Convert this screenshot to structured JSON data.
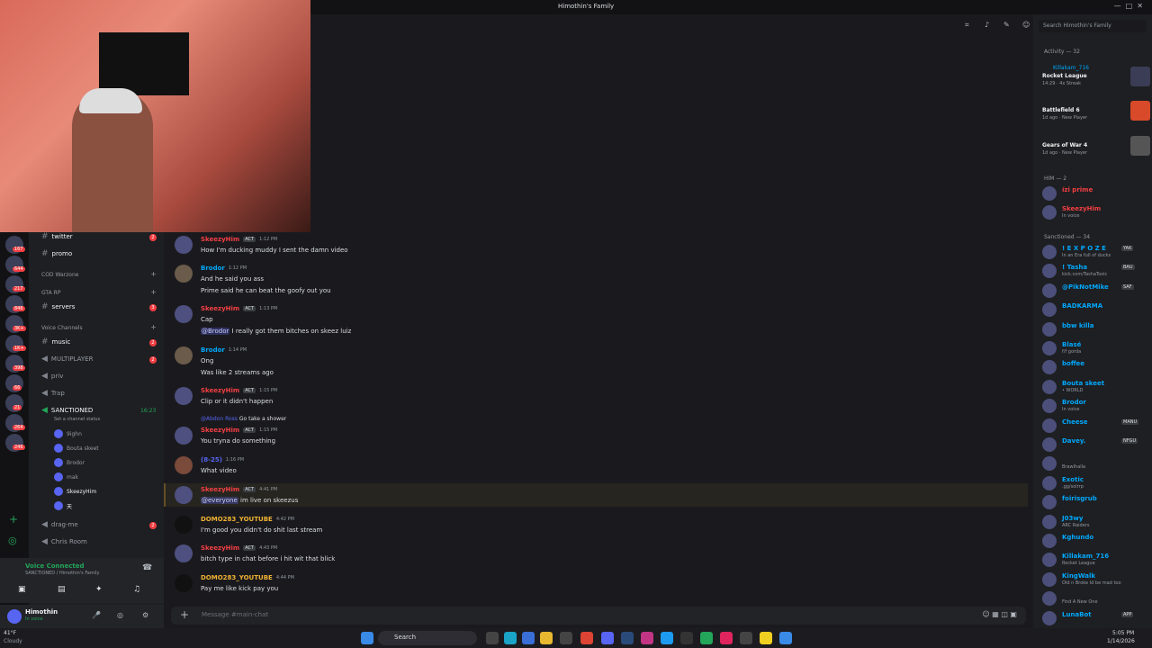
{
  "window": {
    "title": "Himothin's Family"
  },
  "search": {
    "placeholder": "Search Himothin's Family"
  },
  "server_badges": [
    "167",
    "644",
    "217",
    "846",
    "3K+",
    "1K+",
    "398",
    "66",
    "21",
    "264",
    "246"
  ],
  "channels": {
    "twitter": "twitter",
    "promo": "promo",
    "cat_cod": "COD Warzone",
    "cat_gta": "GTA RP",
    "servers": "servers",
    "cat_voice": "Voice Channels",
    "music": "music",
    "multiplayer": "MULTIPLAYER",
    "priv": "priv",
    "trap": "Trap",
    "sanctioned": "SANCTIONED",
    "sanctioned_time": "16:23",
    "set_status": "Set a channel status",
    "voice_users": [
      "9ighn",
      "Bouta skeet",
      "Brodor",
      "mak",
      "SkeezyHim",
      "天"
    ],
    "drag_me": "drag-me",
    "chris_room": "Chris Room",
    "badges": {
      "twitter": "2",
      "servers": "3",
      "music": "2",
      "multiplayer": "2",
      "drag_me": "2"
    }
  },
  "voice": {
    "status": "Voice Connected",
    "location": "SANCTIONED / Himothin's Family"
  },
  "user": {
    "name": "Himothin",
    "status": "In voice"
  },
  "weather": {
    "temp": "41°F",
    "desc": "Cloudy"
  },
  "messages": [
    {
      "author": "SkeezyHim",
      "tag": "ACT",
      "time": "1:12 PM",
      "lines": [
        "How I'm ducking muddy I sent the damn video"
      ]
    },
    {
      "author": "Brodor",
      "tag": "",
      "time": "1:12 PM",
      "lines": [
        "And he said you ass",
        "Prime said he can beat the goofy out you"
      ]
    },
    {
      "author": "SkeezyHim",
      "tag": "ACT",
      "time": "1:13 PM",
      "lines": [
        "Cap"
      ],
      "mention_line": {
        "mention": "@Brodor",
        "text": " I really got them bitches on skeez luiz"
      }
    },
    {
      "author": "Brodor",
      "tag": "",
      "time": "1:14 PM",
      "lines": [
        "Ong",
        "Was like 2 streams ago"
      ]
    },
    {
      "author": "SkeezyHim",
      "tag": "ACT",
      "time": "1:15 PM",
      "lines": [
        "Clip or it didn't happen"
      ]
    },
    {
      "author": "SkeezyHim",
      "tag": "ACT",
      "time": "1:15 PM",
      "reply": {
        "mention": "@Abdon Ross",
        "text": "Go take a shower"
      },
      "lines": [
        "You tryna do something"
      ]
    },
    {
      "author": "(8-25)",
      "tag": "",
      "time": "1:16 PM",
      "lines": [
        "What video"
      ]
    },
    {
      "author": "SkeezyHim",
      "tag": "ACT",
      "time": "4:41 PM",
      "mention_line": {
        "mention": "@everyone",
        "text": " im live on skeezus"
      }
    },
    {
      "author": "DOMO283_YOUTUBE",
      "tag": "",
      "time": "4:42 PM",
      "lines": [
        "I'm good you didn't do shit last stream"
      ]
    },
    {
      "author": "SkeezyHim",
      "tag": "ACT",
      "time": "4:43 PM",
      "lines": [
        "bitch type in chat before i hit wit that blick"
      ]
    },
    {
      "author": "DOMO283_YOUTUBE",
      "tag": "",
      "time": "4:44 PM",
      "lines": [
        "Pay me like kick pay you"
      ]
    }
  ],
  "input": {
    "placeholder": "Message #main-chat"
  },
  "members": {
    "activity_label": "Activity — 32",
    "activities": [
      {
        "who": "Killakam_716",
        "game": "Rocket League",
        "meta": "14:29 · 4x Streak"
      },
      {
        "who": "",
        "game": "Battlefield 6",
        "meta": "1d ago · New Player"
      },
      {
        "who": "",
        "game": "Gears of War 4",
        "meta": "1d ago · New Player"
      }
    ],
    "him_label": "HIM — 2",
    "him": [
      {
        "name": "ízi prime",
        "status": "",
        "color": "#f23f43"
      },
      {
        "name": "SkeezyHim",
        "status": "In voice",
        "color": "#f23f43",
        "tag": "ACT"
      }
    ],
    "sanctioned_label": "Sanctioned — 34",
    "sanctioned": [
      {
        "name": "! E X P O Z E",
        "status": "In an Era full of ducks",
        "color": "#00a8fc",
        "tag": "YAK"
      },
      {
        "name": "! Tasha",
        "status": "kick.com/TashaToxic",
        "color": "#00a8fc",
        "tag": "BAU"
      },
      {
        "name": "@PikNotMike",
        "status": "",
        "color": "#00a8fc",
        "tag": "SAF"
      },
      {
        "name": "BADKARMA",
        "status": "",
        "color": "#00a8fc"
      },
      {
        "name": "bbw killa",
        "status": "",
        "color": "#00a8fc"
      },
      {
        "name": "Blasé",
        "status": "f/f gorda",
        "color": "#00a8fc"
      },
      {
        "name": "boffee",
        "status": "",
        "color": "#00a8fc"
      },
      {
        "name": "Bouta skeet",
        "status": "• WORLD",
        "color": "#00a8fc"
      },
      {
        "name": "Brodor",
        "status": "In voice",
        "color": "#00a8fc"
      },
      {
        "name": "Cheese",
        "status": "",
        "color": "#00a8fc",
        "tag": "MANU"
      },
      {
        "name": "Davey.",
        "status": "",
        "color": "#00a8fc",
        "tag": "NFGU"
      },
      {
        "name": "",
        "status": "Brawlhalla",
        "color": "#f23f43"
      },
      {
        "name": "Exotic",
        "status": ".gg/solrrp",
        "color": "#00a8fc"
      },
      {
        "name": "foirisgrub",
        "status": "",
        "color": "#00a8fc"
      },
      {
        "name": "J03wy",
        "status": "ARC Raiders",
        "color": "#00a8fc"
      },
      {
        "name": "Kghundo",
        "status": "",
        "color": "#00a8fc"
      },
      {
        "name": "Killakam_716",
        "status": "Rocket League",
        "color": "#00a8fc"
      },
      {
        "name": "KingWalk",
        "status": "Old n Broke Id be mad too",
        "color": "#00a8fc"
      },
      {
        "name": "",
        "status": "Find A New One",
        "color": "#f23f43"
      },
      {
        "name": "LunaBot",
        "status": "",
        "color": "#00a8fc",
        "tag": "APP"
      }
    ]
  },
  "taskbar": {
    "search": "Search",
    "time": "5:05 PM",
    "date": "1/14/2026"
  },
  "colors": {
    "skeezy": "#f23f43",
    "brodor": "#00a8fc",
    "domo": "#f0b232",
    "mention": "#5865f2"
  }
}
